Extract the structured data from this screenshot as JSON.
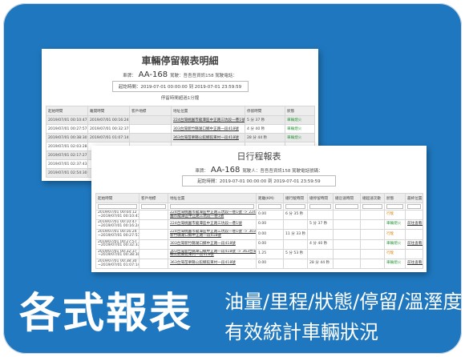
{
  "win1": {
    "title": "車輛停留報表明細",
    "plate_label": "車牌：",
    "plate": "AA-168",
    "driver_text": "駕駛：吾吾吾資訊158  駕駛電話：",
    "period": "起訖時間：2019-07-01 00:00:00 到 2019-07-01 23:59:59",
    "subtitle": "停留時間超過1分鐘",
    "columns": [
      "起始時間",
      "離開時間",
      "客戶地標",
      "地址位置",
      "停留時間",
      "狀態"
    ],
    "rows": [
      [
        "2019/07/01 00:10:47",
        "2019/07/01 00:16:24",
        "",
        "224台灣桃園市龍潭區中正路三坑段一巷1號",
        "5 分 37 秒",
        "車輛熄火"
      ],
      [
        "2019/07/01 00:27:57",
        "2019/07/01 00:32:37",
        "",
        "303台灣新竹縣湖口鄉中正路一段418號",
        "4 分 40 秒",
        "車輛熄火"
      ],
      [
        "2019/07/01 00:38:30",
        "2019/07/01 01:07:14",
        "",
        "363台灣苗栗縣公館鄉館東村一段418號",
        "28 分 44 秒",
        "車輛熄火"
      ],
      [
        "2019/07/01 02:03:28",
        "",
        "",
        "",
        "",
        ""
      ],
      [
        "2019/07/01 02:17:27",
        "",
        "",
        "",
        "",
        ""
      ],
      [
        "2019/07/01 02:37:43",
        "",
        "",
        "",
        "",
        ""
      ],
      [
        "2019/07/01 02:54:30",
        "",
        "",
        "",
        "",
        ""
      ]
    ]
  },
  "win2": {
    "title": "日行程報表",
    "plate_label": "車牌：",
    "plate": "AA-168",
    "driver_text": "駕駛人：吾吾吾資訊158  駕駛電話號碼：",
    "period": "起訖時間：2019-07-01 00:00:00 到 2019-07-01 23:59:59",
    "columns": [
      "起始時間",
      "客戶地標",
      "地址位置",
      "距離(KM)",
      "總行駛時間",
      "總停留時間",
      "總怠速時間",
      "總超速次數",
      "狀態",
      "最終位置地圖"
    ],
    "rows": [
      [
        "2019/07/01 00:04:12\n~2019/07/01 00:10:47",
        "",
        "224台灣桃園市龍潭區中正路三坑段一巷1號 -> 224台灣桃\n園市龍潭區中正路三坑段一巷1號",
        "0.00",
        "6 分 35 秒",
        "",
        "",
        "",
        "行駛",
        ""
      ],
      [
        "2019/07/01 00:10:47\n~2019/07/01 00:16:24",
        "",
        "224台灣桃園市龍潭區中正路三坑段一巷1號",
        "0.00",
        "",
        "5 分 37 秒",
        "",
        "",
        "車輛熄火",
        "前往查看地點"
      ],
      [
        "2019/07/01 00:16:24\n~2019/07/01 00:27:57",
        "",
        "224台灣桃園市龍潭區中正路三坑段一巷1號 -> 303台灣\n新竹縣湖口鄉中正路一段418號",
        "0.00",
        "11 分 33 秒",
        "",
        "",
        "",
        "行駛",
        ""
      ],
      [
        "2019/07/01 00:27:57\n~2019/07/01 00:32:37",
        "",
        "303台灣新竹縣湖口鄉中正路一段418號",
        "0.00",
        "",
        "4 分 40 秒",
        "",
        "",
        "車輛熄火",
        "前往查看地點"
      ],
      [
        "2019/07/01 00:32:37\n~2019/07/01 00:38:30",
        "",
        "303台灣新竹縣湖口鄉中正路一段418號 -> 363台灣苗栗\n縣公館鄉館東村一段418號",
        "1.25",
        "5 分 53 秒",
        "",
        "",
        "",
        "行駛",
        ""
      ],
      [
        "2019/07/01 00:38:30\n~2019/07/01 01:07:14",
        "",
        "363台灣苗栗縣公館鄉館東村一段418號",
        "0.00",
        "",
        "28 分 44 秒",
        "",
        "",
        "車輛熄火",
        "前往查看地點"
      ]
    ]
  },
  "banner": {
    "main": "各式報表",
    "line1": "油量/里程/狀態/停留/溫溼度",
    "line2": "有效統計車輛狀況"
  },
  "colors": {
    "background": "#1f78bf",
    "status_green": "#2a9a3a",
    "status_orange": "#e08a1e"
  }
}
